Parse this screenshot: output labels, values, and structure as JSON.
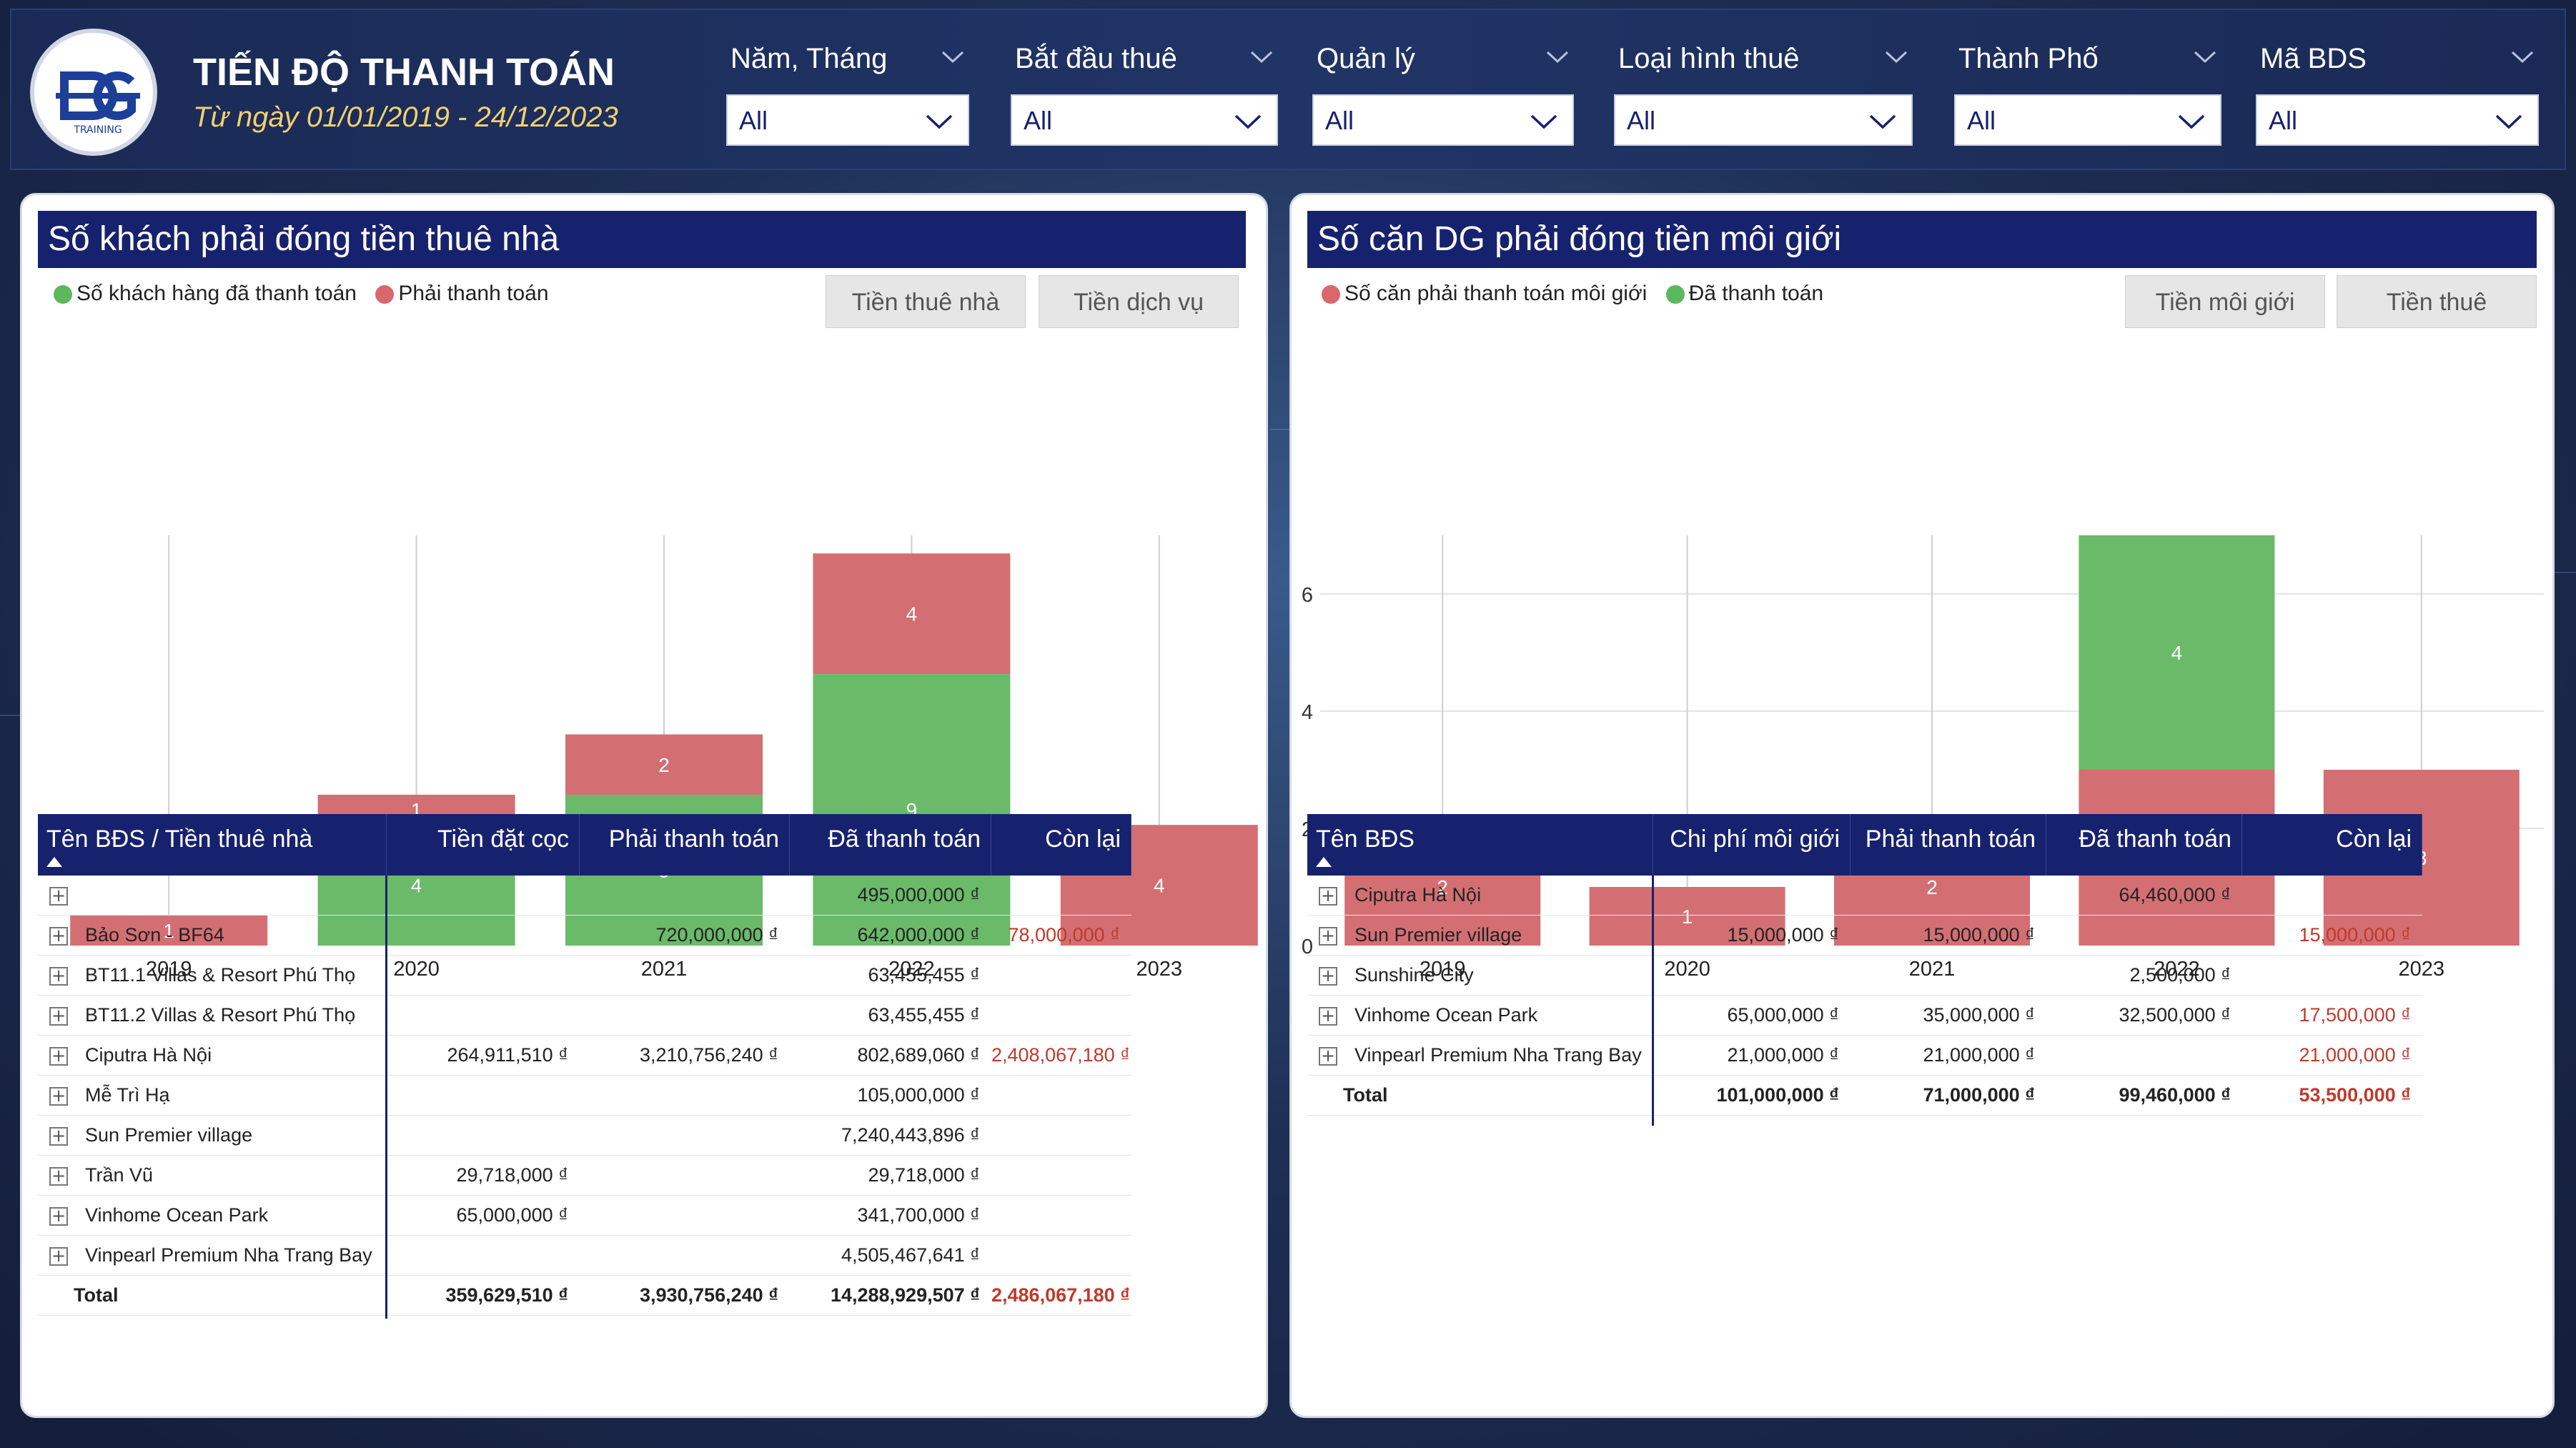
{
  "header": {
    "title": "TIẾN ĐỘ THANH TOÁN",
    "subtitle": "Từ ngày 01/01/2019 - 24/12/2023",
    "logo_text": "TRAINING"
  },
  "filters": [
    {
      "label": "Năm, Tháng",
      "value": "All"
    },
    {
      "label": "Bắt đầu thuê",
      "value": "All"
    },
    {
      "label": "Quản lý",
      "value": "All"
    },
    {
      "label": "Loại hình thuê",
      "value": "All"
    },
    {
      "label": "Thành Phố",
      "value": "All"
    },
    {
      "label": "Mã BDS",
      "value": "All"
    }
  ],
  "colors": {
    "green": "#6aba6a",
    "red": "#d36f73",
    "navy": "#17226f"
  },
  "left_panel": {
    "title": "Số khách phải đóng tiền thuê nhà",
    "legend": [
      {
        "label": "Số khách hàng đã thanh toán",
        "color": "#5cb85c"
      },
      {
        "label": "Phải thanh toán",
        "color": "#d9676c"
      }
    ],
    "toggles": [
      "Tiền thuê nhà",
      "Tiền dịch vụ"
    ],
    "table": {
      "headers": [
        "Tên BĐS / Tiền thuê nhà",
        "Tiền đặt cọc",
        "Phải thanh toán",
        "Đã thanh toán",
        "Còn lại"
      ],
      "rows": [
        [
          "",
          "",
          "",
          "495,000,000 ₫",
          ""
        ],
        [
          "Bảo Sơn - BF64",
          "",
          "720,000,000 ₫",
          "642,000,000 ₫",
          "78,000,000 ₫"
        ],
        [
          "BT11.1 Villas & Resort Phú Thọ",
          "",
          "",
          "63,455,455 ₫",
          ""
        ],
        [
          "BT11.2 Villas & Resort Phú Thọ",
          "",
          "",
          "63,455,455 ₫",
          ""
        ],
        [
          "Ciputra Hà Nội",
          "264,911,510 ₫",
          "3,210,756,240 ₫",
          "802,689,060 ₫",
          "2,408,067,180 ₫"
        ],
        [
          "Mễ Trì Hạ",
          "",
          "",
          "105,000,000 ₫",
          ""
        ],
        [
          "Sun Premier village",
          "",
          "",
          "7,240,443,896 ₫",
          ""
        ],
        [
          "Trần Vũ",
          "29,718,000 ₫",
          "",
          "29,718,000 ₫",
          ""
        ],
        [
          "Vinhome Ocean Park",
          "65,000,000 ₫",
          "",
          "341,700,000 ₫",
          ""
        ],
        [
          "Vinpearl Premium Nha Trang Bay",
          "",
          "",
          "4,505,467,641 ₫",
          ""
        ]
      ],
      "total": [
        "Total",
        "359,629,510 ₫",
        "3,930,756,240 ₫",
        "14,288,929,507 ₫",
        "2,486,067,180 ₫"
      ]
    }
  },
  "right_panel": {
    "title": "Số căn DG phải đóng tiền môi giới",
    "legend": [
      {
        "label": "Số căn phải thanh toán môi giới",
        "color": "#d9676c"
      },
      {
        "label": "Đã thanh toán",
        "color": "#5cb85c"
      }
    ],
    "toggles": [
      "Tiền môi giới",
      "Tiền thuê"
    ],
    "table": {
      "headers": [
        "Tên BĐS",
        "Chi phí môi giới",
        "Phải thanh toán",
        "Đã thanh toán",
        "Còn lại"
      ],
      "rows": [
        [
          "Ciputra Hà Nội",
          "",
          "",
          "64,460,000 ₫",
          ""
        ],
        [
          "Sun Premier village",
          "15,000,000 ₫",
          "15,000,000 ₫",
          "",
          "15,000,000 ₫"
        ],
        [
          "Sunshine City",
          "",
          "",
          "2,500,000 ₫",
          ""
        ],
        [
          "Vinhome Ocean Park",
          "65,000,000 ₫",
          "35,000,000 ₫",
          "32,500,000 ₫",
          "17,500,000 ₫"
        ],
        [
          "Vinpearl Premium Nha Trang Bay",
          "21,000,000 ₫",
          "21,000,000 ₫",
          "",
          "21,000,000 ₫"
        ]
      ],
      "total": [
        "Total",
        "101,000,000 ₫",
        "71,000,000 ₫",
        "99,460,000 ₫",
        "53,500,000 ₫"
      ]
    }
  },
  "chart_data": [
    {
      "type": "bar",
      "stacked": true,
      "categories": [
        "2019",
        "2020",
        "2021",
        "2022",
        "2023"
      ],
      "series": [
        {
          "name": "Số khách hàng đã thanh toán",
          "color": "#6aba6a",
          "values": [
            0,
            4,
            5,
            9,
            0
          ]
        },
        {
          "name": "Phải thanh toán",
          "color": "#d36f73",
          "values": [
            1,
            1,
            2,
            4,
            4
          ]
        }
      ],
      "ylim": [
        0,
        13.6
      ],
      "y_axis_shown": false
    },
    {
      "type": "bar",
      "stacked": true,
      "categories": [
        "2019",
        "2020",
        "2021",
        "2022",
        "2023"
      ],
      "series": [
        {
          "name": "Số căn phải thanh toán môi giới",
          "color": "#d36f73",
          "values": [
            2,
            1,
            2,
            3,
            3
          ]
        },
        {
          "name": "Đã thanh toán",
          "color": "#6aba6a",
          "values": [
            0,
            0,
            0,
            4,
            0
          ]
        }
      ],
      "ylim": [
        0,
        7
      ],
      "yticks": [
        0,
        2,
        4,
        6
      ],
      "y_axis_shown": true
    }
  ]
}
